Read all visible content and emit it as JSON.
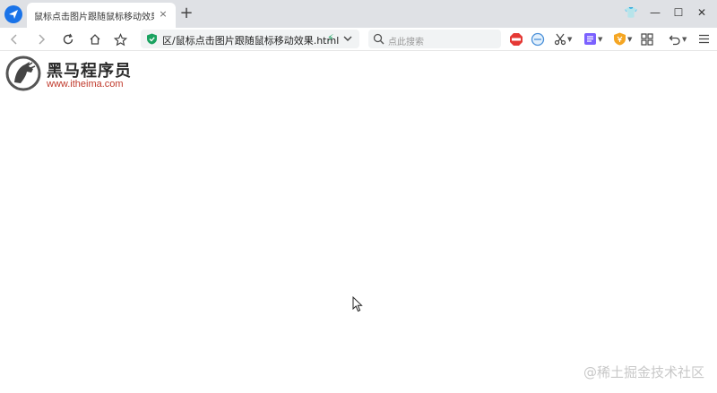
{
  "tab": {
    "title": "鼠标点击图片跟随鼠标移动效果-黑马",
    "close_label": "×",
    "new_tab_label": "+"
  },
  "window": {
    "skin_label": "👕",
    "minimize_label": "—",
    "maximize_label": "☐",
    "close_label": "✕"
  },
  "address": {
    "url": "区/鼠标点击图片跟随鼠标移动效果.html",
    "bolt": "⚡"
  },
  "search": {
    "placeholder": "点此搜索"
  },
  "page": {
    "logo_name": "黑马程序员",
    "logo_url": "www.itheima.com"
  },
  "watermark": "@稀土掘金技术社区",
  "colors": {
    "tabstrip": "#dfe1e5",
    "accent": "#1a73e8",
    "secure_green": "#1aa260",
    "logo_red": "#c0392b"
  }
}
